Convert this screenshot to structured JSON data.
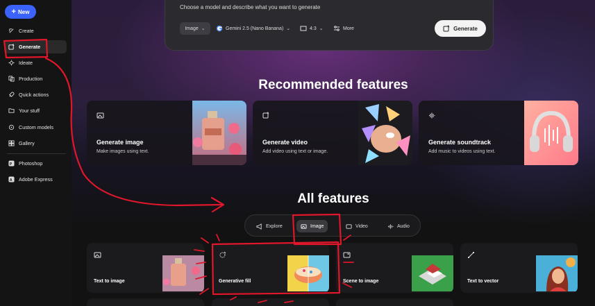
{
  "sidebar": {
    "new_label": "New",
    "items": [
      {
        "label": "Create",
        "icon": "create-icon"
      },
      {
        "label": "Generate",
        "icon": "generate-icon"
      },
      {
        "label": "Ideate",
        "icon": "ideate-icon"
      },
      {
        "label": "Production",
        "icon": "production-icon"
      },
      {
        "label": "Quick actions",
        "icon": "rocket-icon"
      },
      {
        "label": "Your stuff",
        "icon": "folder-icon"
      },
      {
        "label": "Custom models",
        "icon": "custom-models-icon"
      },
      {
        "label": "Gallery",
        "icon": "gallery-icon"
      }
    ],
    "apps": [
      {
        "label": "Photoshop",
        "icon": "photoshop-icon"
      },
      {
        "label": "Adobe Express",
        "icon": "adobe-express-icon"
      }
    ]
  },
  "prompt": {
    "placeholder": "Choose a model and describe what you want to generate",
    "type": "Image",
    "model": "Gemini 2.5 (Nano Banana)",
    "ratio": "4:3",
    "more": "More",
    "generate": "Generate"
  },
  "recommended": {
    "title": "Recommended features",
    "cards": [
      {
        "title": "Generate image",
        "subtitle": "Make images using text."
      },
      {
        "title": "Generate video",
        "subtitle": "Add video using text or image."
      },
      {
        "title": "Generate soundtrack",
        "subtitle": "Add music to videos using text."
      }
    ]
  },
  "all_features": {
    "title": "All features",
    "tabs": [
      "Explore",
      "Image",
      "Video",
      "Audio"
    ],
    "selected_tab": "Image",
    "cards": [
      {
        "title": "Text to image"
      },
      {
        "title": "Generative fill"
      },
      {
        "title": "Scene to image"
      },
      {
        "title": "Text to vector"
      }
    ]
  },
  "colors": {
    "accent": "#3b63fb",
    "annotation": "#e0162b"
  }
}
